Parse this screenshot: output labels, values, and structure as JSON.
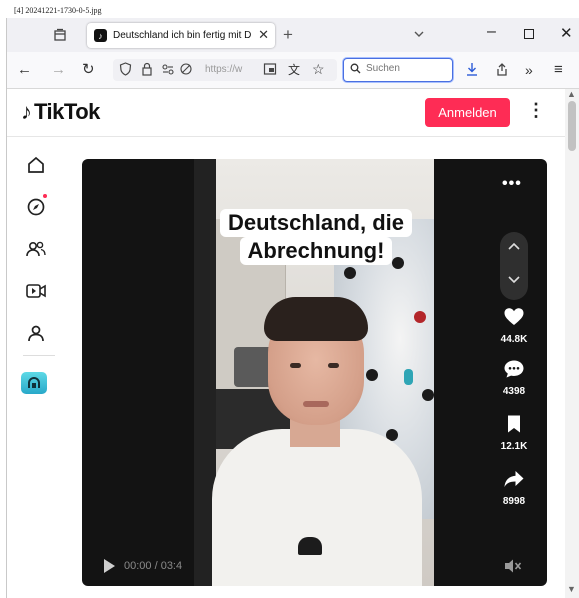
{
  "file_label": "[4] 20241221-1730-0-5.jpg",
  "browser": {
    "tab": {
      "title": "Deutschland ich bin fertig mit D"
    },
    "url_text": "https://w",
    "search": {
      "placeholder": "Suchen"
    }
  },
  "tiktok": {
    "logo_text": "TikTok",
    "login_label": "Anmelden",
    "sidebar": [
      {
        "name": "home-icon"
      },
      {
        "name": "explore-icon"
      },
      {
        "name": "following-icon"
      },
      {
        "name": "live-icon"
      },
      {
        "name": "profile-icon"
      }
    ],
    "video": {
      "caption_line1": "Deutschland, die",
      "caption_line2": "Abrechnung!",
      "likes": "44.8K",
      "comments": "4398",
      "saves": "12.1K",
      "shares": "8998",
      "time": "00:00 / 03:4"
    }
  },
  "colors": {
    "brand": "#fe2c55",
    "search_focus": "#4a6fe0"
  }
}
